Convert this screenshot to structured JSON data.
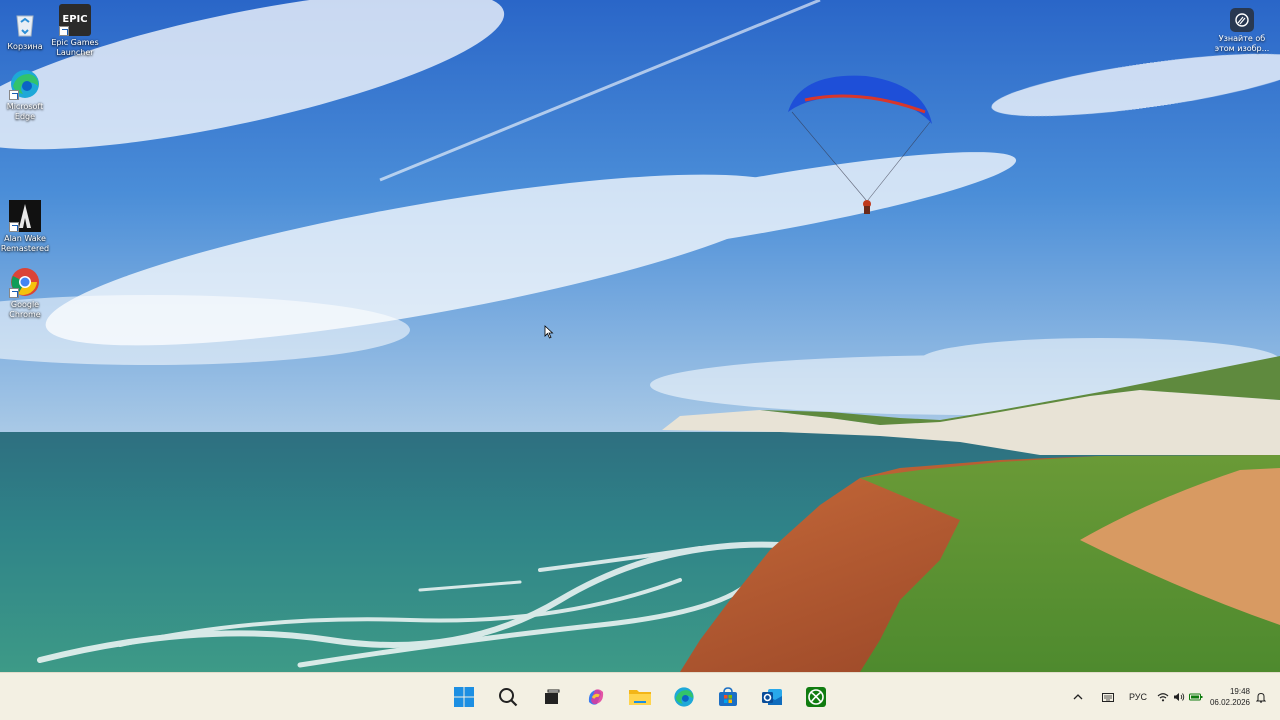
{
  "desktop_icons": [
    {
      "name": "recycle-bin",
      "label": "Корзина"
    },
    {
      "name": "epic-games",
      "label": "Epic Games Launcher",
      "logo_text": "EPIC"
    },
    {
      "name": "microsoft-edge",
      "label": "Microsoft Edge"
    },
    {
      "name": "alan-wake",
      "label": "Alan Wake Remastered"
    },
    {
      "name": "google-chrome",
      "label": "Google Chrome"
    }
  ],
  "learn_widget": {
    "label": "Узнайте об этом изобр..."
  },
  "taskbar": {
    "apps": [
      {
        "name": "start",
        "icon": "windows-logo-icon"
      },
      {
        "name": "search",
        "icon": "search-icon"
      },
      {
        "name": "task-view",
        "icon": "task-view-icon"
      },
      {
        "name": "copilot",
        "icon": "copilot-icon"
      },
      {
        "name": "file-explorer",
        "icon": "folder-icon"
      },
      {
        "name": "edge",
        "icon": "edge-icon"
      },
      {
        "name": "store",
        "icon": "store-icon"
      },
      {
        "name": "outlook",
        "icon": "outlook-icon"
      },
      {
        "name": "xbox",
        "icon": "xbox-icon"
      }
    ],
    "tray": {
      "language": "РУС",
      "time": "19:48",
      "date": "06.02.2026"
    }
  },
  "colors": {
    "taskbar_bg": "#f3f0e3",
    "sky_top": "#2a66c8",
    "sea": "#2c7f86",
    "grass": "#5c9a35",
    "cliff": "#c0633a",
    "paraglider": "#1e4fd8"
  }
}
